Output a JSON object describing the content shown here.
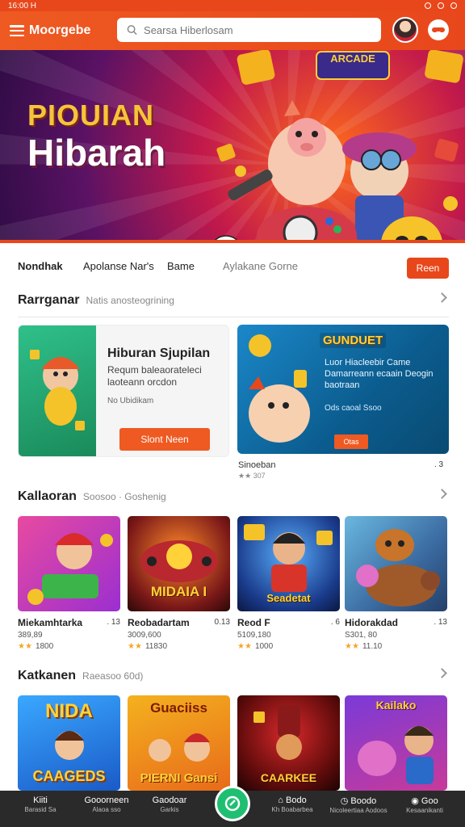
{
  "status": {
    "left": "16:00 H"
  },
  "header": {
    "brand": "Moorgebe",
    "search_placeholder": "Searsa Hiberlosam"
  },
  "hero": {
    "subtitle": "PIOUIAN",
    "title": "Hibarah",
    "badge": "ARCADE"
  },
  "categories": {
    "items": [
      "Nondhak",
      "Apolanse Nar's",
      "Bame",
      "Aylakane Gorne"
    ],
    "button": "Reen"
  },
  "section1": {
    "title": "Rarrganar",
    "subtitle": "Natis anosteogrining"
  },
  "featured": {
    "card1": {
      "title": "Hiburan Sjupilan",
      "desc": "Requm baleaorateleci laoteann orcdon",
      "meta": "No Ubidikam",
      "button": "Slont Neen"
    },
    "card2": {
      "badge": "GUNDUET",
      "desc": "Luor Hiacleebir Came Damarreann ecaain Deogin baotraan",
      "meta": "Ods caoal Ssoo",
      "button": "Otas",
      "caption": "Sinoeban",
      "caption_meta": "★★ 307",
      "num": ". 3"
    }
  },
  "section2": {
    "title": "Kallaoran",
    "subtitle": "Soosoo · Goshenig"
  },
  "games": [
    {
      "name": "Miekamhtarka",
      "num": ". 13",
      "price": "389,89",
      "stars": "★★",
      "rating": "1800",
      "label": ""
    },
    {
      "name": "Reobadartam",
      "num": "0.13",
      "price": "3009,600",
      "stars": "★★",
      "rating": "11830",
      "label": "MIDAIA I"
    },
    {
      "name": "Reod F",
      "num": ". 6",
      "price": "5109,180",
      "stars": "★★",
      "rating": "1000",
      "label": "Seadetat"
    },
    {
      "name": "Hidorakdad",
      "num": ". 13",
      "price": "S301, 80",
      "stars": "★★",
      "rating": "11.10",
      "label": ""
    }
  ],
  "section3": {
    "title": "Katkanen",
    "subtitle": "Raeasoo 60d)"
  },
  "games2": [
    {
      "label_top": "NIDA",
      "label_bottom": "CAAGEDS"
    },
    {
      "label_top": "Guaciiss",
      "label_bottom": "PIERNI Gansi"
    },
    {
      "label_top": "",
      "label_bottom": "CAARKEE"
    },
    {
      "label_top": "Kailako",
      "label_bottom": ""
    }
  ],
  "bottom_nav": [
    {
      "label": "Kiiti",
      "sub": "Barasid Sa"
    },
    {
      "label": "Gooorneen",
      "sub": "Alaoa sso"
    },
    {
      "label": "Gaodoar",
      "sub": "Garkis"
    },
    {
      "label": "Bodo",
      "sub": "Kh Boabarbea"
    },
    {
      "label": "Boodo",
      "sub": "Nicoleertiaa Aodoos"
    },
    {
      "label": "Goo",
      "sub": "Kesaanikanti"
    }
  ]
}
